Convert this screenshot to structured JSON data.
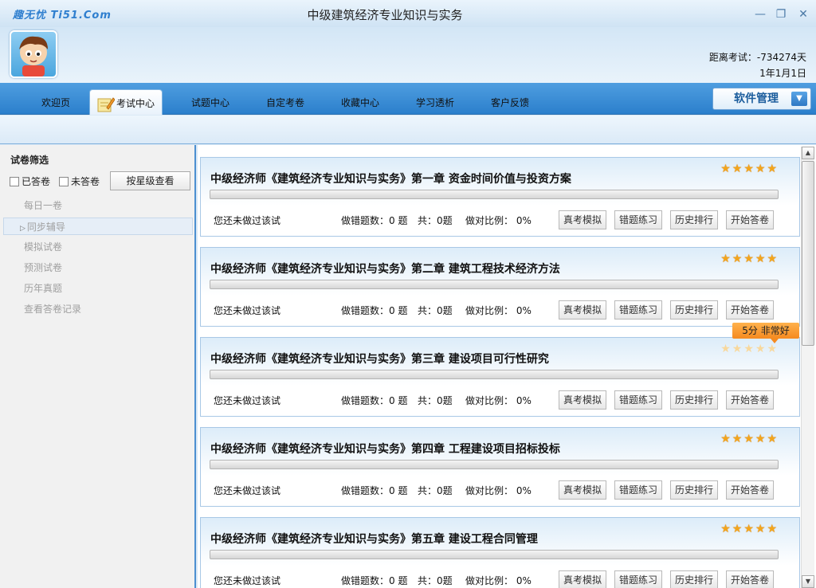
{
  "window": {
    "brand": "趣无忧 Ti51.Com",
    "title": "中级建筑经济专业知识与实务",
    "controls": {
      "minimize": "—",
      "restore": "❐",
      "close": "✕"
    }
  },
  "header": {
    "countdown_label": "距离考试：-734274天",
    "date": "1年1月1日"
  },
  "nav": {
    "tabs": [
      "欢迎页",
      "考试中心",
      "试题中心",
      "自定考卷",
      "收藏中心",
      "学习透析",
      "客户反馈"
    ],
    "active": "考试中心",
    "software_manage": "软件管理"
  },
  "sidebar": {
    "filter_title": "试卷筛选",
    "answered": "已答卷",
    "unanswered": "未答卷",
    "star_view": "按星级查看",
    "items": [
      "每日一卷",
      "同步辅导",
      "模拟试卷",
      "预测试卷",
      "历年真题",
      "查看答卷记录"
    ],
    "selected": "同步辅导"
  },
  "tooltip": "5分  非常好",
  "cards": [
    {
      "title": "中级经济师《建筑经济专业知识与实务》第一章  资金时间价值与投资方案",
      "stars": 5,
      "status": "您还未做过该试",
      "wrong": "做错题数：0 题",
      "total": "共：0题",
      "ratio": "做对比例： 0%",
      "progress": 0
    },
    {
      "title": "中级经济师《建筑经济专业知识与实务》第二章  建筑工程技术经济方法",
      "stars": 5,
      "status": "您还未做过该试",
      "wrong": "做错题数：0 题",
      "total": "共：0题",
      "ratio": "做对比例： 0%",
      "progress": 0
    },
    {
      "title": "中级经济师《建筑经济专业知识与实务》第三章  建设项目可行性研究",
      "stars": 5,
      "status": "您还未做过该试",
      "wrong": "做错题数：0 题",
      "total": "共：0题",
      "ratio": "做对比例： 0%",
      "progress": 0
    },
    {
      "title": "中级经济师《建筑经济专业知识与实务》第四章  工程建设项目招标投标",
      "stars": 5,
      "status": "您还未做过该试",
      "wrong": "做错题数：0 题",
      "total": "共：0题",
      "ratio": "做对比例： 0%",
      "progress": 0
    },
    {
      "title": "中级经济师《建筑经济专业知识与实务》第五章  建设工程合同管理",
      "stars": 5,
      "status": "您还未做过该试",
      "wrong": "做错题数：0 题",
      "total": "共：0题",
      "ratio": "做对比例： 0%",
      "progress": 0
    }
  ],
  "card_buttons": [
    "真考模拟",
    "错题练习",
    "历史排行",
    "开始答卷"
  ]
}
